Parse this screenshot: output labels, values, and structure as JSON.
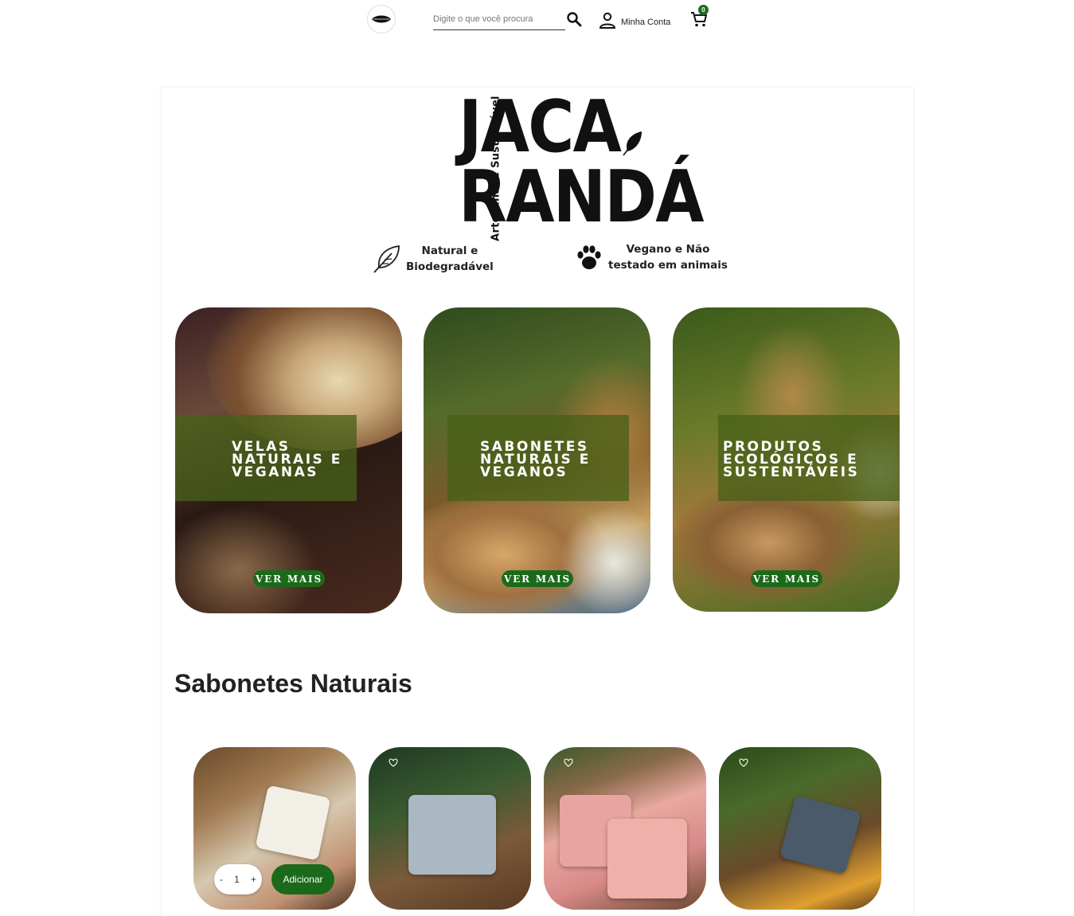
{
  "header": {
    "search_placeholder": "Digite o que você procura",
    "account_label": "Minha Conta",
    "cart_count": "0"
  },
  "brand": {
    "line1": "JACA",
    "line2": "RANDÁ",
    "tagline": "Artesanal e Sustentável",
    "features": [
      {
        "line1": "Natural e",
        "line2": "Biodegradável",
        "icon": "leaf-icon"
      },
      {
        "line1": "Vegano e Não",
        "line2": "testado em animais",
        "icon": "paw-icon"
      }
    ]
  },
  "categories": [
    {
      "lines": [
        "VELAS",
        "NATURAIS E",
        "VEGANAS"
      ],
      "button": "VER MAIS"
    },
    {
      "lines": [
        "SABONETES",
        "NATURAIS E",
        "VEGANOS"
      ],
      "button": "VER MAIS"
    },
    {
      "lines": [
        "PRODUTOS",
        "ECOLÓGICOS E",
        "SUSTENTÁVEIS"
      ],
      "button": "VER MAIS"
    }
  ],
  "products_section": {
    "title": "Sabonetes Naturais",
    "quantity": "1",
    "qty_minus": "-",
    "qty_plus": "+",
    "add_label": "Adicionar"
  },
  "colors": {
    "accent_green": "#1b6a1b",
    "band_green": "#486018"
  }
}
